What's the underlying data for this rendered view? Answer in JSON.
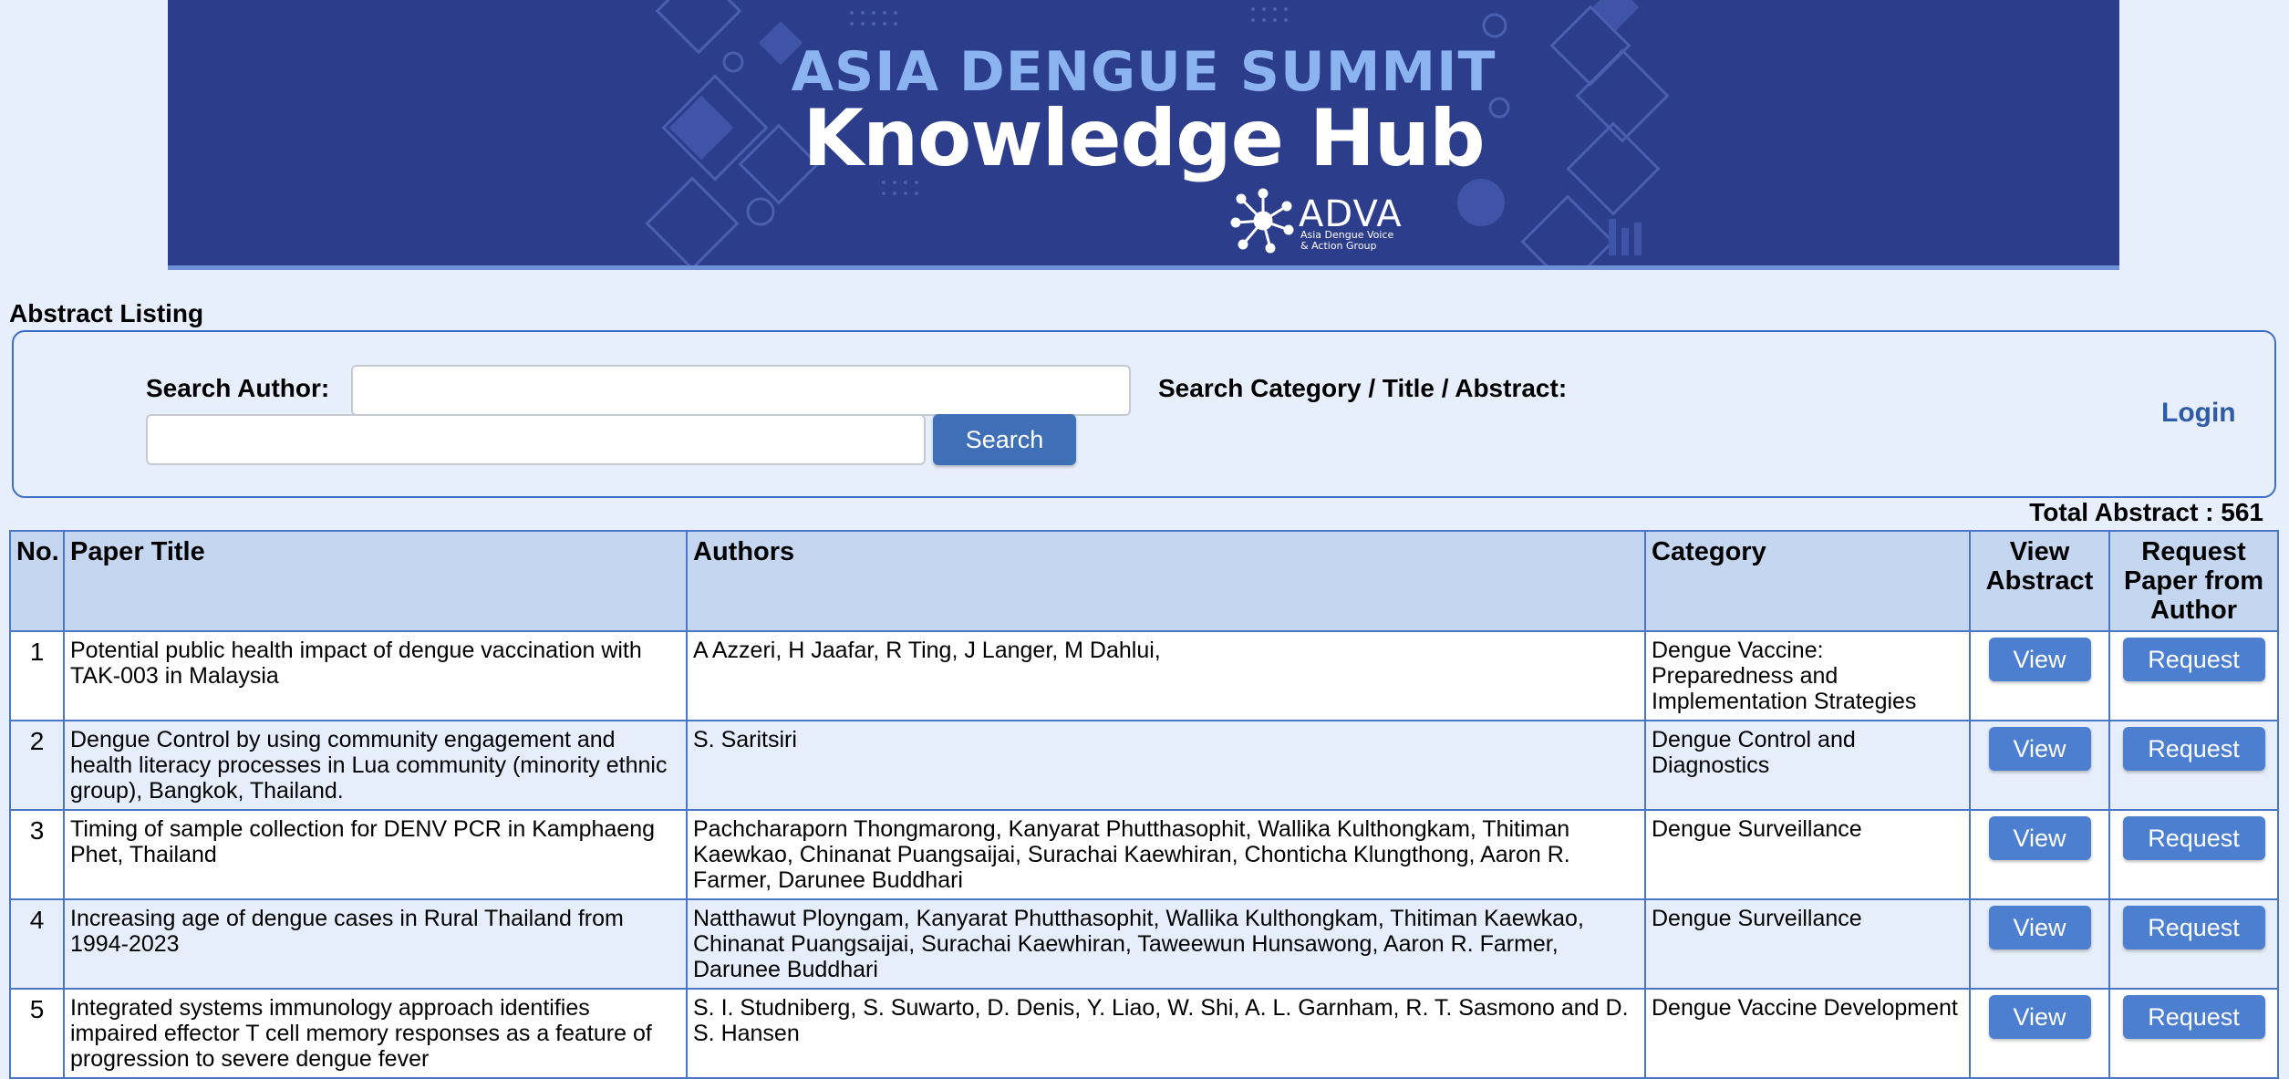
{
  "banner": {
    "line1": "ASIA DENGUE SUMMIT",
    "line2": "Knowledge Hub",
    "logo_text": "ADVA",
    "logo_sub": "Asia Dengue Voice & Action Group"
  },
  "page": {
    "heading": "Abstract Listing"
  },
  "search": {
    "author_label": "Search Author:",
    "author_value": "",
    "category_label": "Search Category / Title / Abstract:",
    "category_value": "",
    "button_label": "Search",
    "login_label": "Login"
  },
  "total": "Total Abstract : 561",
  "table": {
    "headers": {
      "no": "No.",
      "title": "Paper Title",
      "authors": "Authors",
      "category": "Category",
      "view": "View Abstract",
      "request": "Request Paper from Author"
    },
    "view_label": "View",
    "request_label": "Request",
    "rows": [
      {
        "no": "1",
        "title": "Potential public health impact of dengue vaccination with TAK-003 in Malaysia",
        "authors": "A Azzeri, H Jaafar, R Ting, J Langer, M Dahlui,",
        "category": "Dengue Vaccine: Preparedness and Implementation Strategies"
      },
      {
        "no": "2",
        "title": "Dengue Control by using community engagement and health literacy processes in Lua community (minority ethnic group), Bangkok, Thailand.",
        "authors": "S. Saritsiri",
        "category": "Dengue Control and Diagnostics"
      },
      {
        "no": "3",
        "title": "Timing of sample collection for DENV PCR in Kamphaeng Phet, Thailand",
        "authors": "Pachcharaporn Thongmarong, Kanyarat Phutthasophit, Wallika Kulthongkam, Thitiman Kaewkao, Chinanat Puangsaijai, Surachai Kaewhiran, Chonticha Klungthong, Aaron R. Farmer, Darunee Buddhari",
        "category": "Dengue Surveillance"
      },
      {
        "no": "4",
        "title": "Increasing age of dengue cases in Rural Thailand from 1994-2023",
        "authors": "Natthawut Ployngam, Kanyarat Phutthasophit, Wallika Kulthongkam, Thitiman Kaewkao, Chinanat Puangsaijai, Surachai Kaewhiran, Taweewun Hunsawong, Aaron R. Farmer, Darunee Buddhari",
        "category": "Dengue Surveillance"
      },
      {
        "no": "5",
        "title": "Integrated systems immunology approach identifies impaired effector T cell memory responses as a feature of progression to severe dengue fever",
        "authors": "S. I. Studniberg, S. Suwarto, D. Denis, Y. Liao, W. Shi, A. L. Garnham, R. T. Sasmono and D. S. Hansen",
        "category": "Dengue Vaccine Development"
      }
    ]
  },
  "colors": {
    "banner_bg": "#2c3d8c",
    "page_bg": "#e8effc",
    "accent": "#3f6fb6",
    "header_bg": "#c5d6f1"
  }
}
